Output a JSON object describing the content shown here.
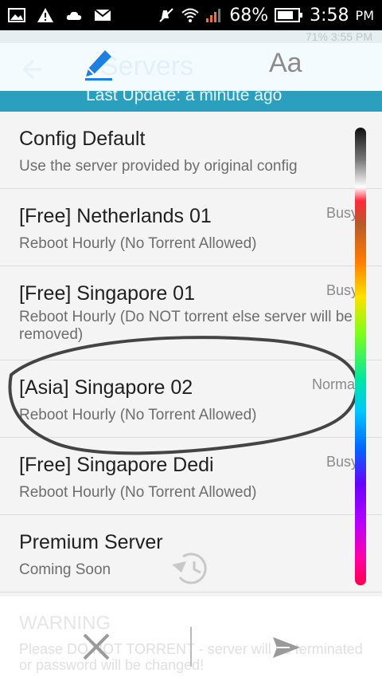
{
  "status_bar": {
    "battery_percent": "68%",
    "time": "3:58",
    "ampm": "PM"
  },
  "ghost_header": {
    "left": "",
    "right": "71% 3:55 PM"
  },
  "toolbar": {
    "title": "Servers",
    "font_tab_label": "Aa"
  },
  "header": {
    "last_update": "Last Update: a minute ago"
  },
  "servers": [
    {
      "title": "Config Default",
      "desc": "Use the server provided by original config",
      "status": ""
    },
    {
      "title": "[Free] Netherlands 01",
      "desc": "Reboot Hourly (No Torrent Allowed)",
      "status": "Busy"
    },
    {
      "title": "[Free] Singapore 01",
      "desc": "Reboot Hourly (Do NOT torrent else server will be removed)",
      "status": "Busy"
    },
    {
      "title": "[Asia] Singapore 02",
      "desc": "Reboot Hourly (No Torrent Allowed)",
      "status": "Normal"
    },
    {
      "title": "[Free] Singapore Dedi",
      "desc": "Reboot Hourly (No Torrent Allowed)",
      "status": "Busy"
    },
    {
      "title": "Premium Server",
      "desc": "Coming Soon",
      "status": ""
    }
  ],
  "warning": {
    "title": "WARNING",
    "text": "Please DO NOT TORRENT - server will be terminated or password will be changed!"
  },
  "colors": {
    "accent": "#2c9fbf",
    "pencil": "#1e7fe3",
    "annotation": "#444444"
  }
}
